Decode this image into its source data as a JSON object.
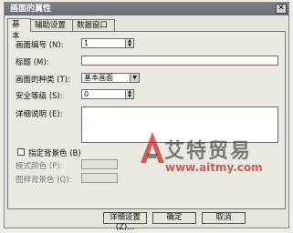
{
  "window": {
    "title": "画面的属性",
    "close_glyph": "✕"
  },
  "tabs": [
    {
      "label": "基本"
    },
    {
      "label": "辅助设置"
    },
    {
      "label": "数据窗口"
    }
  ],
  "fields": {
    "screen_number": {
      "label": "画面编号 (N):",
      "value": "1"
    },
    "title": {
      "label": "标题 (M):",
      "value": ""
    },
    "screen_type": {
      "label": "画面的种类 (T):",
      "value": "基本画面"
    },
    "security_level": {
      "label": "安全等级 (S):",
      "value": "0"
    },
    "description": {
      "label": "详细说明 (E):"
    },
    "bg_color": {
      "label": "指定背景色 (B)"
    },
    "pattern_color": {
      "label": "模式颜色 (P):"
    },
    "pattern_bg_color": {
      "label": "图样背景色 (Q):"
    }
  },
  "buttons": {
    "detail": "详细设置(Z)...",
    "ok": "确定",
    "cancel": "取消"
  },
  "watermark": {
    "brand": "艾特贸易",
    "url": "www.aitmy.com"
  }
}
